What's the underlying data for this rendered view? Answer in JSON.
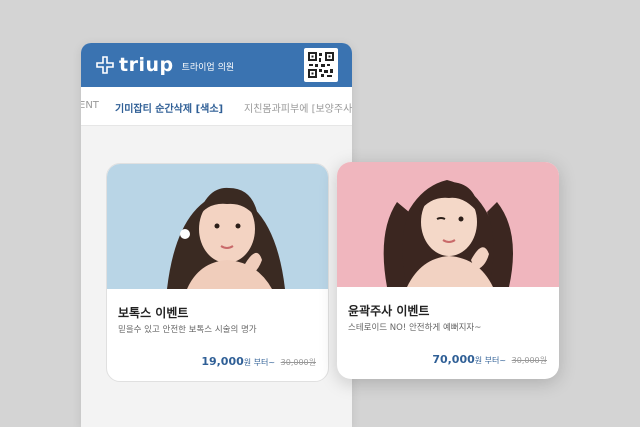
{
  "app": {
    "brand": "triup",
    "clinic_name": "트라이업 의원",
    "qr_icon": "qr-code-icon"
  },
  "tabs": [
    {
      "label": "ENT"
    },
    {
      "label": "기미잡티 순간삭제 [색소]"
    },
    {
      "label": "지친몸과피부에 [보양주사]"
    }
  ],
  "cards": [
    {
      "title": "보톡스 이벤트",
      "description": "믿을수 있고 안전한 보톡스 시술의 명가",
      "price": "19,000",
      "price_unit": "원 부터~",
      "old_price": "30,000원"
    },
    {
      "title": "윤곽주사 이벤트",
      "description": "스테로이드 NO! 안전하게 예뻐지자~",
      "price": "70,000",
      "price_unit": "원 부터~",
      "old_price": "30,000원"
    }
  ],
  "colors": {
    "brand_blue": "#3a73b1",
    "price_blue": "#2f5f96",
    "background": "#d4d4d4",
    "card1_photo_bg": "#b9d5e6",
    "card2_photo_bg": "#f0b6be"
  }
}
